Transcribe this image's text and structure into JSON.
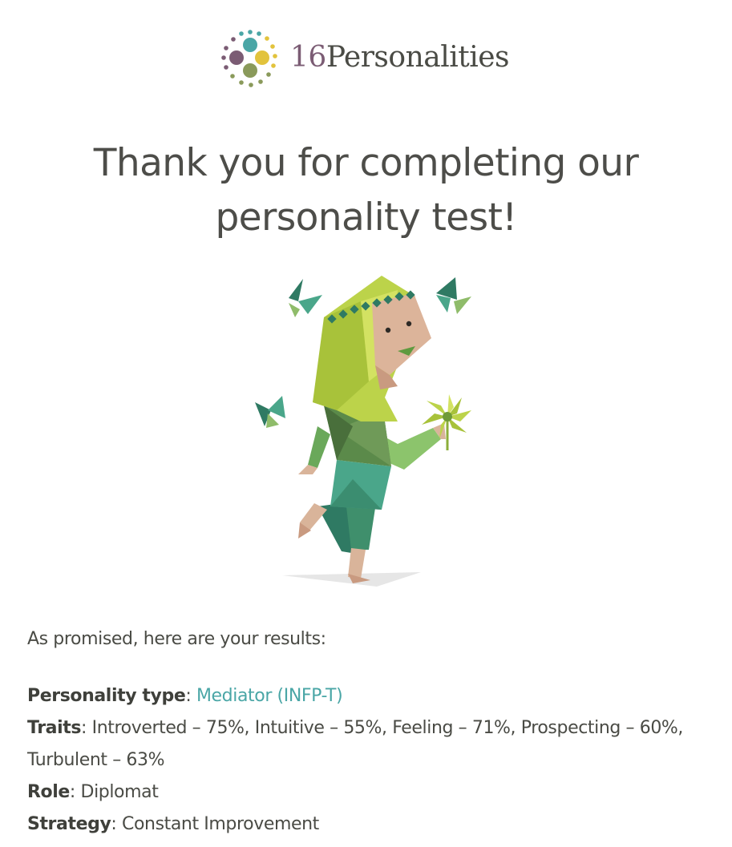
{
  "brand": {
    "logo_number": "16",
    "logo_word": "Personalities"
  },
  "headline": "Thank you for completing our personality test!",
  "illustration": {
    "icon": "mediator-character-illustration"
  },
  "results": {
    "intro": "As promised, here are your results:",
    "personality_type": {
      "label": "Personality type",
      "value": "Mediator (INFP-T)"
    },
    "traits": {
      "label": "Traits",
      "value": "Introverted – 75%, Intuitive – 55%, Feeling – 71%, Prospecting – 60%, Turbulent – 63%"
    },
    "role": {
      "label": "Role",
      "value": "Diplomat"
    },
    "strategy": {
      "label": "Strategy",
      "value": "Constant Improvement"
    }
  },
  "colors": {
    "accent": "#4aa6a6",
    "text": "#4a4b45",
    "logo_number": "#7b5c74"
  }
}
